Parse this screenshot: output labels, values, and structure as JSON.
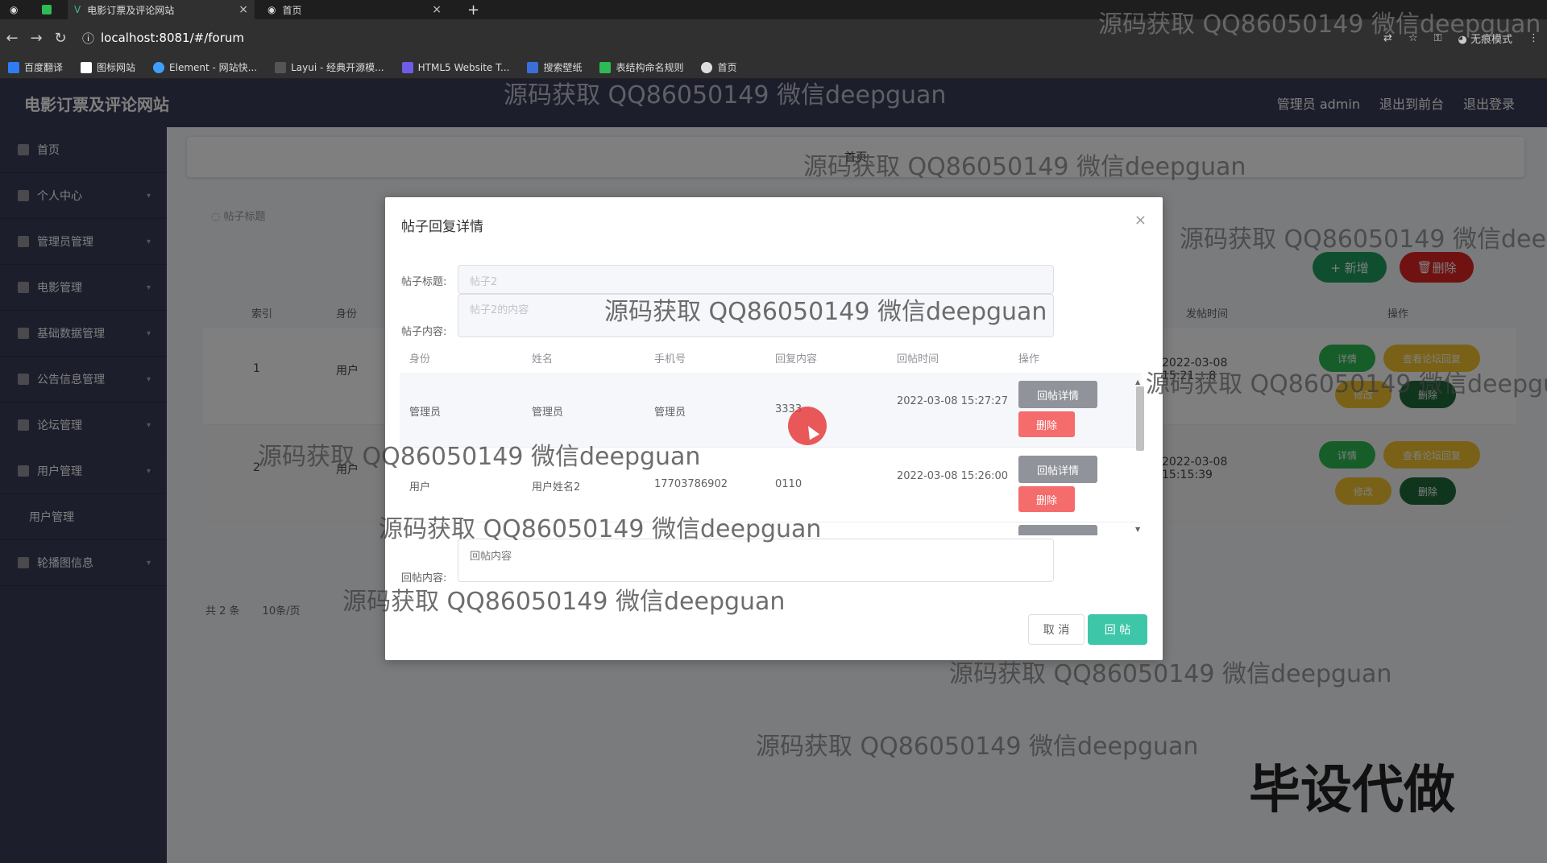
{
  "browser": {
    "tabs": [
      {
        "title": "电影订票及评论网站",
        "active": true
      },
      {
        "title": "首页",
        "active": false
      }
    ],
    "url_host": "localhost:8081/#/forum",
    "incognito_label": "无痕模式",
    "bookmarks": [
      "百度翻译",
      "图标网站",
      "Element - 网站快...",
      "Layui - 经典开源模...",
      "HTML5 Website T...",
      "搜索壁纸",
      "表结构命名规则",
      "首页"
    ]
  },
  "app": {
    "title": "电影订票及评论网站",
    "header_links": [
      "管理员 admin",
      "退出到前台",
      "退出登录"
    ],
    "sidebar": [
      {
        "label": "首页",
        "sub": false,
        "arrow": false
      },
      {
        "label": "个人中心",
        "sub": false,
        "arrow": true
      },
      {
        "label": "管理员管理",
        "sub": false,
        "arrow": true
      },
      {
        "label": "电影管理",
        "sub": false,
        "arrow": true
      },
      {
        "label": "基础数据管理",
        "sub": false,
        "arrow": true
      },
      {
        "label": "公告信息管理",
        "sub": false,
        "arrow": true
      },
      {
        "label": "论坛管理",
        "sub": false,
        "arrow": true
      },
      {
        "label": "用户管理",
        "sub": false,
        "arrow": true
      },
      {
        "label": "用户管理",
        "sub": true,
        "arrow": false
      },
      {
        "label": "轮播图信息",
        "sub": false,
        "arrow": true
      }
    ],
    "breadcrumb": "首页",
    "filter_label": "帖子标题",
    "add_label": "+ 新增",
    "delete_label": "删除",
    "bg_table_headers": [
      "索引",
      "身份",
      "发帖时间",
      "操作"
    ],
    "bg_rows": [
      {
        "index": "1",
        "identity": "用户",
        "time": "2022-03-08 15:21:...8"
      },
      {
        "index": "2",
        "identity": "用户",
        "time": "2022-03-08 15:15:39"
      }
    ],
    "bg_row_actions": {
      "detail": "详情",
      "view_reply": "查看论坛回复",
      "edit": "修改",
      "del": "删除"
    },
    "pager": {
      "total": "共 2 条",
      "per_page": "10条/页"
    }
  },
  "dialog": {
    "title": "帖子回复详情",
    "close_icon": "×",
    "post_title_label": "帖子标题:",
    "post_title_value": "帖子2",
    "post_content_label": "帖子内容:",
    "post_content_value": "帖子2的内容",
    "columns": [
      "身份",
      "姓名",
      "手机号",
      "回复内容",
      "回帖时间",
      "操作"
    ],
    "rows": [
      {
        "identity": "管理员",
        "name": "管理员",
        "phone": "管理员",
        "content": "3333",
        "time": "2022-03-08 15:27:27"
      },
      {
        "identity": "用户",
        "name": "用户姓名2",
        "phone": "17703786902",
        "content": "0110",
        "time": "2022-03-08 15:26:00"
      }
    ],
    "row_detail_btn": "回帖详情",
    "row_delete_btn": "删除",
    "reply_label": "回帖内容:",
    "reply_placeholder": "回帖内容",
    "cancel_label": "取 消",
    "submit_label": "回 帖"
  },
  "watermark": {
    "text": "源码获取 QQ86050149 微信deepguan",
    "big_text": "毕设代做"
  },
  "colors": {
    "sidebar_bg": "#3a3d58",
    "primary_teal": "#3ec6a8",
    "danger": "#f56c6c",
    "info_gray": "#909399"
  }
}
